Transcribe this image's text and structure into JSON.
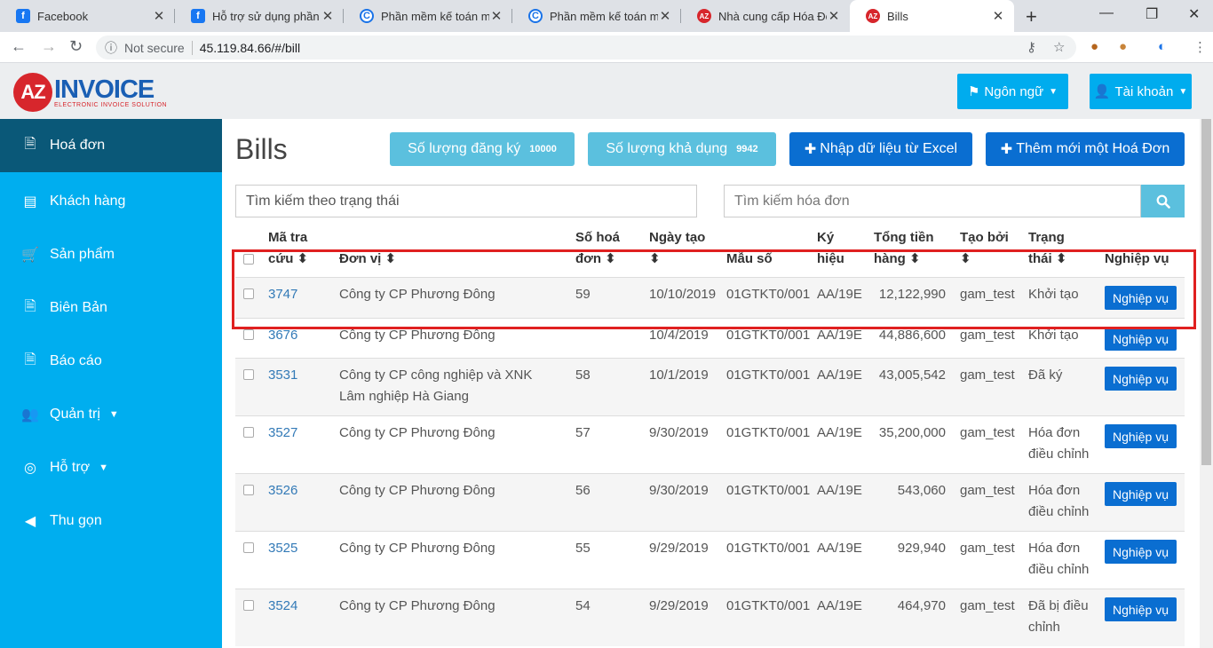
{
  "browser": {
    "tabs": [
      {
        "title": "Facebook",
        "fav": "f",
        "color": "#1877f2"
      },
      {
        "title": "Hỗ trợ sử dụng phần m",
        "fav": "f",
        "color": "#1877f2"
      },
      {
        "title": "Phần mềm kế toán miễ",
        "fav": "C",
        "color": "#1a73e8"
      },
      {
        "title": "Phần mềm kế toán miễ",
        "fav": "C",
        "color": "#1a73e8"
      },
      {
        "title": "Nhà cung cấp Hóa Đơn",
        "fav": "AZ",
        "color": "#d7262c"
      },
      {
        "title": "Bills",
        "fav": "AZ",
        "color": "#d7262c"
      }
    ],
    "security_label": "Not secure",
    "url": "45.119.84.66/#/bill"
  },
  "header": {
    "logo_az": "AZ",
    "logo_invoice": "INVOICE",
    "logo_tagline": "ELECTRONIC INVOICE SOLUTION",
    "language_label": "Ngôn ngữ",
    "account_label": "Tài khoản"
  },
  "sidebar": {
    "items": [
      {
        "label": "Hoá đơn",
        "icon": "file-icon"
      },
      {
        "label": "Khách hàng",
        "icon": "id-card-icon"
      },
      {
        "label": "Sản phẩm",
        "icon": "cart-icon"
      },
      {
        "label": "Biên Bản",
        "icon": "file-icon"
      },
      {
        "label": "Báo cáo",
        "icon": "file-icon"
      },
      {
        "label": "Quản trị",
        "icon": "users-icon"
      },
      {
        "label": "Hỗ trợ",
        "icon": "lifebuoy-icon"
      },
      {
        "label": "Thu gọn",
        "icon": "chevron-left-circle-icon"
      }
    ]
  },
  "main": {
    "title": "Bills",
    "registered_label": "Số lượng đăng ký",
    "registered_count": "10000",
    "available_label": "Số lượng khả dụng",
    "available_count": "9942",
    "import_label": "Nhập dữ liệu từ Excel",
    "add_label": "Thêm mới một Hoá Đơn",
    "status_search_placeholder": "Tìm kiếm theo trạng thái",
    "invoice_search_placeholder": "Tìm kiếm hóa đơn"
  },
  "table": {
    "headers": {
      "lookup_1": "Mã tra",
      "lookup_2": "cứu",
      "unit": "Đơn vị",
      "number_1": "Số hoá",
      "number_2": "đơn",
      "date_1": "Ngày tạo",
      "template": "Mẫu số",
      "symbol_1": "Ký",
      "symbol_2": "hiệu",
      "total_1": "Tổng tiền",
      "total_2": "hàng",
      "creator": "Tạo bởi",
      "status_1": "Trạng",
      "status_2": "thái",
      "action": "Nghiệp vụ"
    },
    "action_label": "Nghiệp vụ",
    "rows": [
      {
        "code": "3747",
        "unit_1": "Công ty CP Phương Đông",
        "unit_2": "",
        "number": "59",
        "date": "10/10/2019",
        "template": "01GTKT0/001",
        "symbol": "AA/19E",
        "total": "12,122,990",
        "creator": "gam_test",
        "status_1": "Khởi tạo",
        "status_2": ""
      },
      {
        "code": "3676",
        "unit_1": "Công ty CP Phương Đông",
        "unit_2": "",
        "number": "",
        "date": "10/4/2019",
        "template": "01GTKT0/001",
        "symbol": "AA/19E",
        "total": "44,886,600",
        "creator": "gam_test",
        "status_1": "Khởi tạo",
        "status_2": ""
      },
      {
        "code": "3531",
        "unit_1": "Công ty CP công nghiệp và XNK",
        "unit_2": "Lâm nghiệp Hà Giang",
        "number": "58",
        "date": "10/1/2019",
        "template": "01GTKT0/001",
        "symbol": "AA/19E",
        "total": "43,005,542",
        "creator": "gam_test",
        "status_1": "Đã ký",
        "status_2": ""
      },
      {
        "code": "3527",
        "unit_1": "Công ty CP Phương Đông",
        "unit_2": "",
        "number": "57",
        "date": "9/30/2019",
        "template": "01GTKT0/001",
        "symbol": "AA/19E",
        "total": "35,200,000",
        "creator": "gam_test",
        "status_1": "Hóa đơn",
        "status_2": "điều chỉnh"
      },
      {
        "code": "3526",
        "unit_1": "Công ty CP Phương Đông",
        "unit_2": "",
        "number": "56",
        "date": "9/30/2019",
        "template": "01GTKT0/001",
        "symbol": "AA/19E",
        "total": "543,060",
        "creator": "gam_test",
        "status_1": "Hóa đơn",
        "status_2": "điều chỉnh"
      },
      {
        "code": "3525",
        "unit_1": "Công ty CP Phương Đông",
        "unit_2": "",
        "number": "55",
        "date": "9/29/2019",
        "template": "01GTKT0/001",
        "symbol": "AA/19E",
        "total": "929,940",
        "creator": "gam_test",
        "status_1": "Hóa đơn",
        "status_2": "điều chỉnh"
      },
      {
        "code": "3524",
        "unit_1": "Công ty CP Phương Đông",
        "unit_2": "",
        "number": "54",
        "date": "9/29/2019",
        "template": "01GTKT0/001",
        "symbol": "AA/19E",
        "total": "464,970",
        "creator": "gam_test",
        "status_1": "Đã bị điều",
        "status_2": "chỉnh"
      }
    ]
  },
  "colors": {
    "sidebar": "#00aeef",
    "sidebar_active": "#0a5878",
    "primary_button": "#0a6ed1",
    "info_button": "#5bc0de",
    "highlight": "#e02020"
  }
}
